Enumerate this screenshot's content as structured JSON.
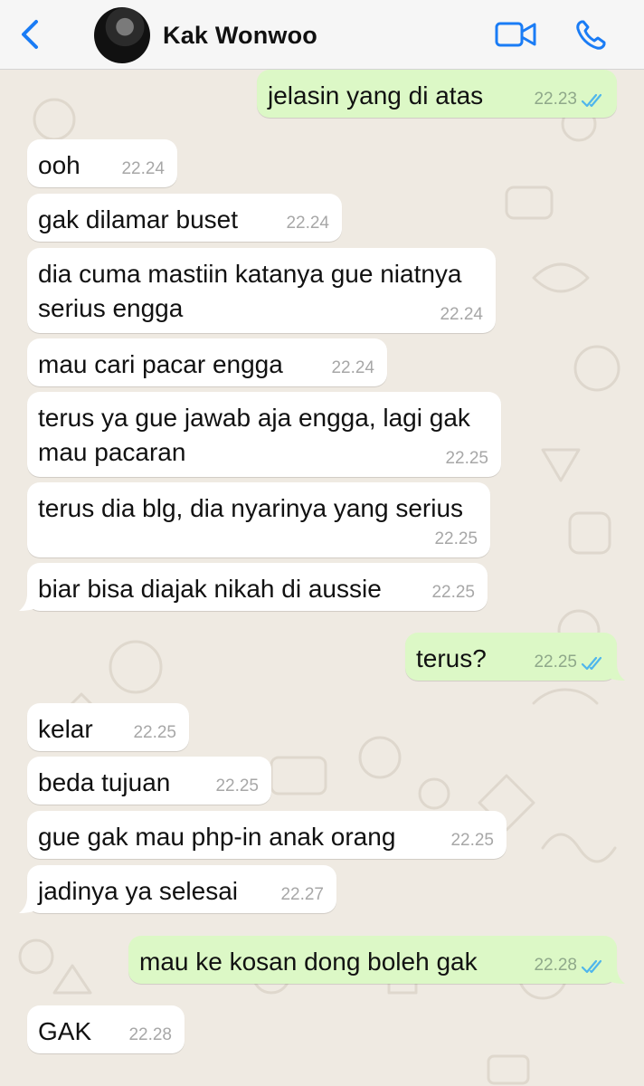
{
  "header": {
    "contact_name": "Kak Wonwoo"
  },
  "icons": {
    "back": "chevron-left",
    "video": "video-camera",
    "call": "phone"
  },
  "colors": {
    "accent": "#1a7cf5",
    "incoming_bubble": "#ffffff",
    "outgoing_bubble": "#dcf8c6",
    "read_ticks": "#4fb6ec",
    "wallpaper": "#efeae2"
  },
  "messages": [
    {
      "dir": "out",
      "text": "jelasin yang di atas",
      "time": "22.23",
      "read": true
    },
    {
      "dir": "in",
      "text": "ooh",
      "time": "22.24"
    },
    {
      "dir": "in",
      "text": "gak dilamar buset",
      "time": "22.24"
    },
    {
      "dir": "in",
      "text": "dia cuma mastiin katanya gue niatnya serius engga",
      "time": "22.24"
    },
    {
      "dir": "in",
      "text": "mau cari pacar engga",
      "time": "22.24"
    },
    {
      "dir": "in",
      "text": "terus ya gue jawab aja engga, lagi gak mau pacaran",
      "time": "22.25"
    },
    {
      "dir": "in",
      "text": "terus dia blg, dia nyarinya yang serius",
      "time": "22.25"
    },
    {
      "dir": "in",
      "text": "biar bisa diajak nikah di aussie",
      "time": "22.25"
    },
    {
      "dir": "out",
      "text": "terus?",
      "time": "22.25",
      "read": true
    },
    {
      "dir": "in",
      "text": "kelar",
      "time": "22.25"
    },
    {
      "dir": "in",
      "text": "beda tujuan",
      "time": "22.25"
    },
    {
      "dir": "in",
      "text": "gue gak mau php-in anak orang",
      "time": "22.25"
    },
    {
      "dir": "in",
      "text": "jadinya ya selesai",
      "time": "22.27"
    },
    {
      "dir": "out",
      "text": "mau ke kosan dong boleh gak",
      "time": "22.28",
      "read": true
    },
    {
      "dir": "in",
      "text": "GAK",
      "time": "22.28"
    }
  ]
}
